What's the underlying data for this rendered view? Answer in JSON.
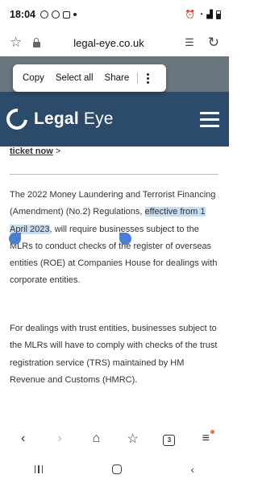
{
  "status_bar": {
    "time": "18:04"
  },
  "url_bar": {
    "url": "legal-eye.co.uk"
  },
  "context_menu": {
    "copy": "Copy",
    "select_all": "Select all",
    "share": "Share"
  },
  "site": {
    "logo_bold": "Legal",
    "logo_light": " Eye"
  },
  "article": {
    "ticket_link": "ticket now",
    "ticket_suffix": " >",
    "para1_a": "The 2022 Money Laundering and Terrorist Financing (Amendment) (No.2) Regulations, ",
    "para1_highlight": "effective from 1 April 2023",
    "para1_b": ", will require businesses subject to the MLRs to conduct checks of the register of overseas entities (ROE) at Companies House for dealings with corporate entities.",
    "para2": "For dealings with trust entities, businesses subject to the MLRs will have to comply with checks of the trust registration service (TRS) maintained by HM Revenue and Customs (HMRC)."
  },
  "toolbar": {
    "tabs_count": "3"
  },
  "colors": {
    "header_bg": "#2c4b6a",
    "selection_bg": "#c7ddf0",
    "handle": "#4a7fd4"
  }
}
